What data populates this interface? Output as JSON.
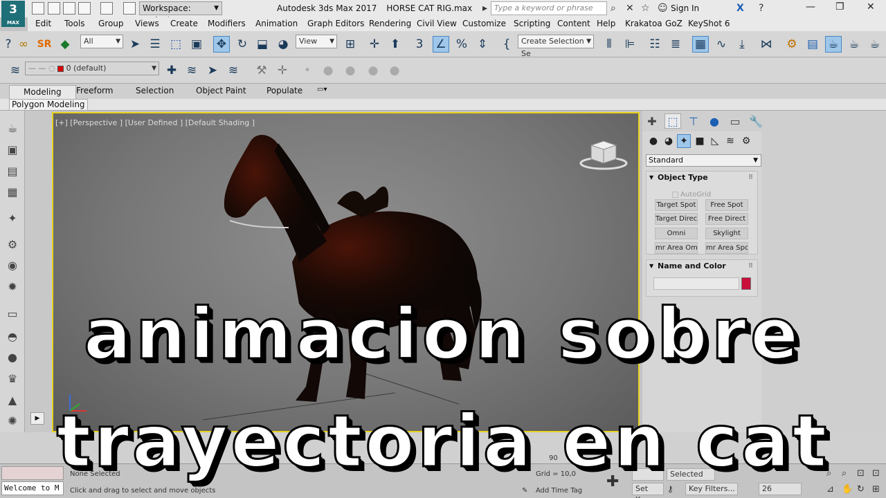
{
  "app": {
    "logo_main": "3",
    "logo_sub": "MAX",
    "workspace": "Workspace: Default",
    "title": "Autodesk 3ds Max 2017",
    "file": "HORSE CAT RIG.max",
    "search_placeholder": "Type a keyword or phrase",
    "sign_in": "Sign In"
  },
  "menu": [
    "Edit",
    "Tools",
    "Group",
    "Views",
    "Create",
    "Modifiers",
    "Animation",
    "Graph Editors",
    "Rendering",
    "Civil View",
    "Customize",
    "Scripting",
    "Content",
    "Help",
    "Krakatoa",
    "GoZ",
    "KeyShot 6"
  ],
  "toolbar": {
    "sr_label": "SR",
    "filter": "All",
    "view": "View",
    "selection_set": "Create Selection Se",
    "layer": "0 (default)"
  },
  "ribbon": {
    "tabs": [
      "Modeling",
      "Freeform",
      "Selection",
      "Object Paint",
      "Populate"
    ],
    "sub": "Polygon Modeling"
  },
  "viewport": {
    "label": "[+] [Perspective ] [User Defined ] [Default Shading ]"
  },
  "command_panel": {
    "category": "Standard",
    "object_type": {
      "title": "Object Type",
      "autogrid": "AutoGrid",
      "buttons": [
        "Target Spot",
        "Free Spot",
        "Target Direct",
        "Free Direct",
        "Omni",
        "Skylight",
        "mr Area Omni",
        "mr Area Spot"
      ]
    },
    "name_color": {
      "title": "Name and Color",
      "color": "#c8103a"
    }
  },
  "status": {
    "welcome": "Welcome to M",
    "selected": "None Selected",
    "prompt": "Click and drag to select and move objects",
    "grid": "Grid = 10,0",
    "add_time_tag": "Add Time Tag",
    "set_key": "Set Key",
    "key_filters": "Key Filters...",
    "frame": "26",
    "timeline_mark": "90",
    "selected_box": "Selected"
  },
  "overlay": {
    "line1": "animacion sobre",
    "line2": "trayectoria en cat"
  }
}
